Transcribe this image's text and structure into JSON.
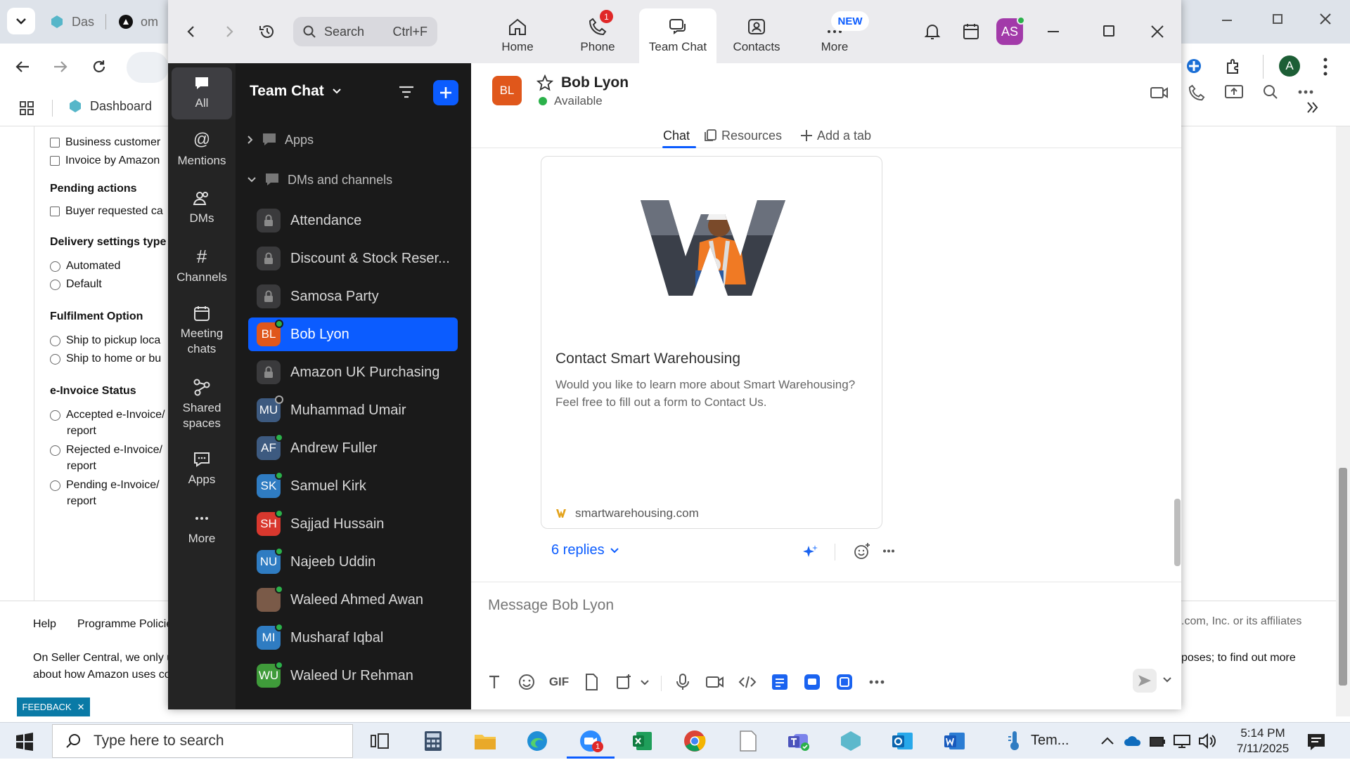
{
  "browser": {
    "tabs": [
      {
        "label": "Das"
      },
      {
        "label": "om"
      }
    ],
    "bookmark_dashboard": "Dashboard",
    "profile_initial": "A"
  },
  "amazon": {
    "filters": [
      {
        "type": "check",
        "label": "Business customer"
      },
      {
        "type": "check",
        "label": "Invoice by Amazon"
      }
    ],
    "pending_head": "Pending actions",
    "pending_item": "Buyer requested ca",
    "delivery_head": "Delivery settings type",
    "delivery_opts": [
      "Automated",
      "Default"
    ],
    "fulfil_head": "Fulfilment Option",
    "fulfil_opts": [
      "Ship to pickup loca",
      "Ship to home or bu"
    ],
    "einv_head": "e-Invoice Status",
    "einv_opts": [
      {
        "label": "Accepted e-Invoice/",
        "sub": "report"
      },
      {
        "label": "Rejected e-Invoice/",
        "sub": "report"
      },
      {
        "label": "Pending e-Invoice/",
        "sub": "report"
      }
    ],
    "footer_links": [
      "Help",
      "Programme Policie"
    ],
    "footer_text1": "On Seller Central, we only u",
    "footer_text2": "about how Amazon uses co",
    "footer_right": ".com, Inc. or its affiliates",
    "footer_right2": "poses; to find out more",
    "feedback": "FEEDBACK"
  },
  "zoom": {
    "search_label": "Search",
    "search_shortcut": "Ctrl+F",
    "nav": [
      {
        "label": "Home"
      },
      {
        "label": "Phone"
      },
      {
        "label": "Team Chat"
      },
      {
        "label": "Contacts"
      },
      {
        "label": "More"
      }
    ],
    "phone_badge": "1",
    "more_badge": "NEW",
    "user_initials": "AS",
    "rail": [
      "All",
      "Mentions",
      "DMs",
      "Channels",
      "Meeting chats",
      "Shared spaces",
      "Apps",
      "More"
    ],
    "list_title": "Team Chat",
    "section_apps": "Apps",
    "section_dms": "DMs and channels",
    "channels": [
      {
        "name": "Attendance",
        "kind": "lock"
      },
      {
        "name": "Discount & Stock Reser...",
        "kind": "lock"
      },
      {
        "name": "Samosa Party",
        "kind": "lock"
      },
      {
        "name": "Bob Lyon",
        "kind": "person",
        "initials": "BL",
        "color": "#e0571b"
      },
      {
        "name": "Amazon UK Purchasing",
        "kind": "lock"
      },
      {
        "name": "Muhammad Umair",
        "kind": "person",
        "initials": "MU",
        "color": "#3d5a80"
      },
      {
        "name": "Andrew Fuller",
        "kind": "person",
        "initials": "AF",
        "color": "#3d5a80"
      },
      {
        "name": "Samuel Kirk",
        "kind": "person",
        "initials": "SK",
        "color": "#2f7cc2"
      },
      {
        "name": "Sajjad Hussain",
        "kind": "person",
        "initials": "SH",
        "color": "#d9382e"
      },
      {
        "name": "Najeeb Uddin",
        "kind": "person",
        "initials": "NU",
        "color": "#2f7cc2"
      },
      {
        "name": "Waleed Ahmed Awan",
        "kind": "person",
        "initials": "",
        "color": "#7a5a48"
      },
      {
        "name": "Musharaf Iqbal",
        "kind": "person",
        "initials": "MI",
        "color": "#2f7cc2"
      },
      {
        "name": "Waleed Ur Rehman",
        "kind": "person",
        "initials": "WU",
        "color": "#3f9b3a"
      }
    ],
    "chat": {
      "avatar": "BL",
      "name": "Bob Lyon",
      "status": "Available",
      "tabs": [
        "Chat",
        "Resources",
        "Add a tab"
      ],
      "card_title": "Contact Smart Warehousing",
      "card_desc": "Would you like to learn more about Smart Warehousing? Feel free to fill out a form to Contact Us.",
      "card_domain": "smartwarehousing.com",
      "replies": "6 replies",
      "compose_placeholder": "Message Bob Lyon",
      "gif_label": "GIF"
    }
  },
  "taskbar": {
    "search_placeholder": "Type here to search",
    "zoom_badge": "1",
    "temp_label": "Tem...",
    "time": "5:14 PM",
    "date": "7/11/2025"
  }
}
